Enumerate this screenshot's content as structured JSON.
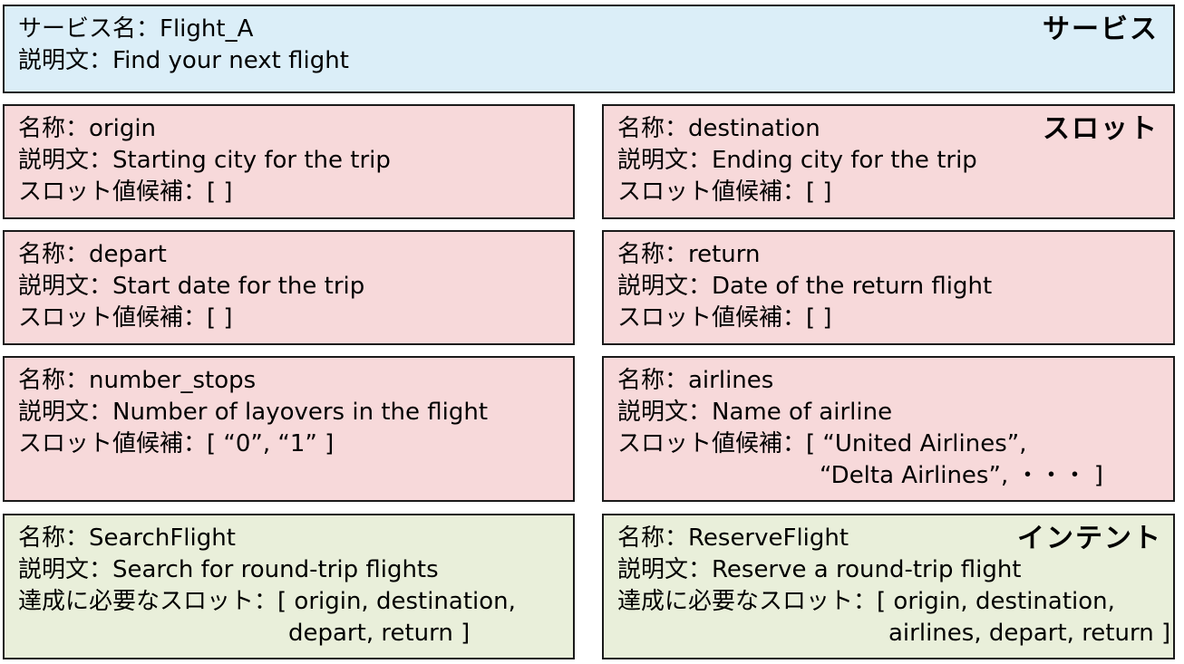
{
  "service": {
    "category": "サービス",
    "name_line": "サービス名：Flight_A",
    "desc_line": "説明文：Find your next flight"
  },
  "slots": {
    "category": "スロット",
    "items": [
      {
        "name": "名称：origin",
        "desc": "説明文：Starting city for the trip",
        "values": "スロット値候補：[ ]"
      },
      {
        "name": "名称：destination",
        "desc": "説明文：Ending city for the trip",
        "values": "スロット値候補：[ ]"
      },
      {
        "name": "名称：depart",
        "desc": "説明文：Start date for the trip",
        "values": "スロット値候補：[ ]"
      },
      {
        "name": "名称：return",
        "desc": "説明文：Date of the return flight",
        "values": "スロット値候補：[ ]"
      },
      {
        "name": "名称：number_stops",
        "desc": "説明文：Number of layovers in the flight",
        "values": "スロット値候補：[ “0”, “1” ]"
      },
      {
        "name": "名称：airlines",
        "desc": "説明文：Name of airline",
        "values": "スロット値候補：[ “United Airlines”,",
        "values_cont": "“Delta Airlines”, ・・・ ]"
      }
    ]
  },
  "intents": {
    "category": "インテント",
    "items": [
      {
        "name": "名称：SearchFlight",
        "desc": "説明文：Search for round-trip flights",
        "required": "達成に必要なスロット：[ origin, destination,",
        "required_cont": "depart, return ]"
      },
      {
        "name": "名称：ReserveFlight",
        "desc": "説明文：Reserve a round-trip flight",
        "required": "達成に必要なスロット：[ origin, destination,",
        "required_cont": "airlines, depart, return ]"
      }
    ]
  }
}
